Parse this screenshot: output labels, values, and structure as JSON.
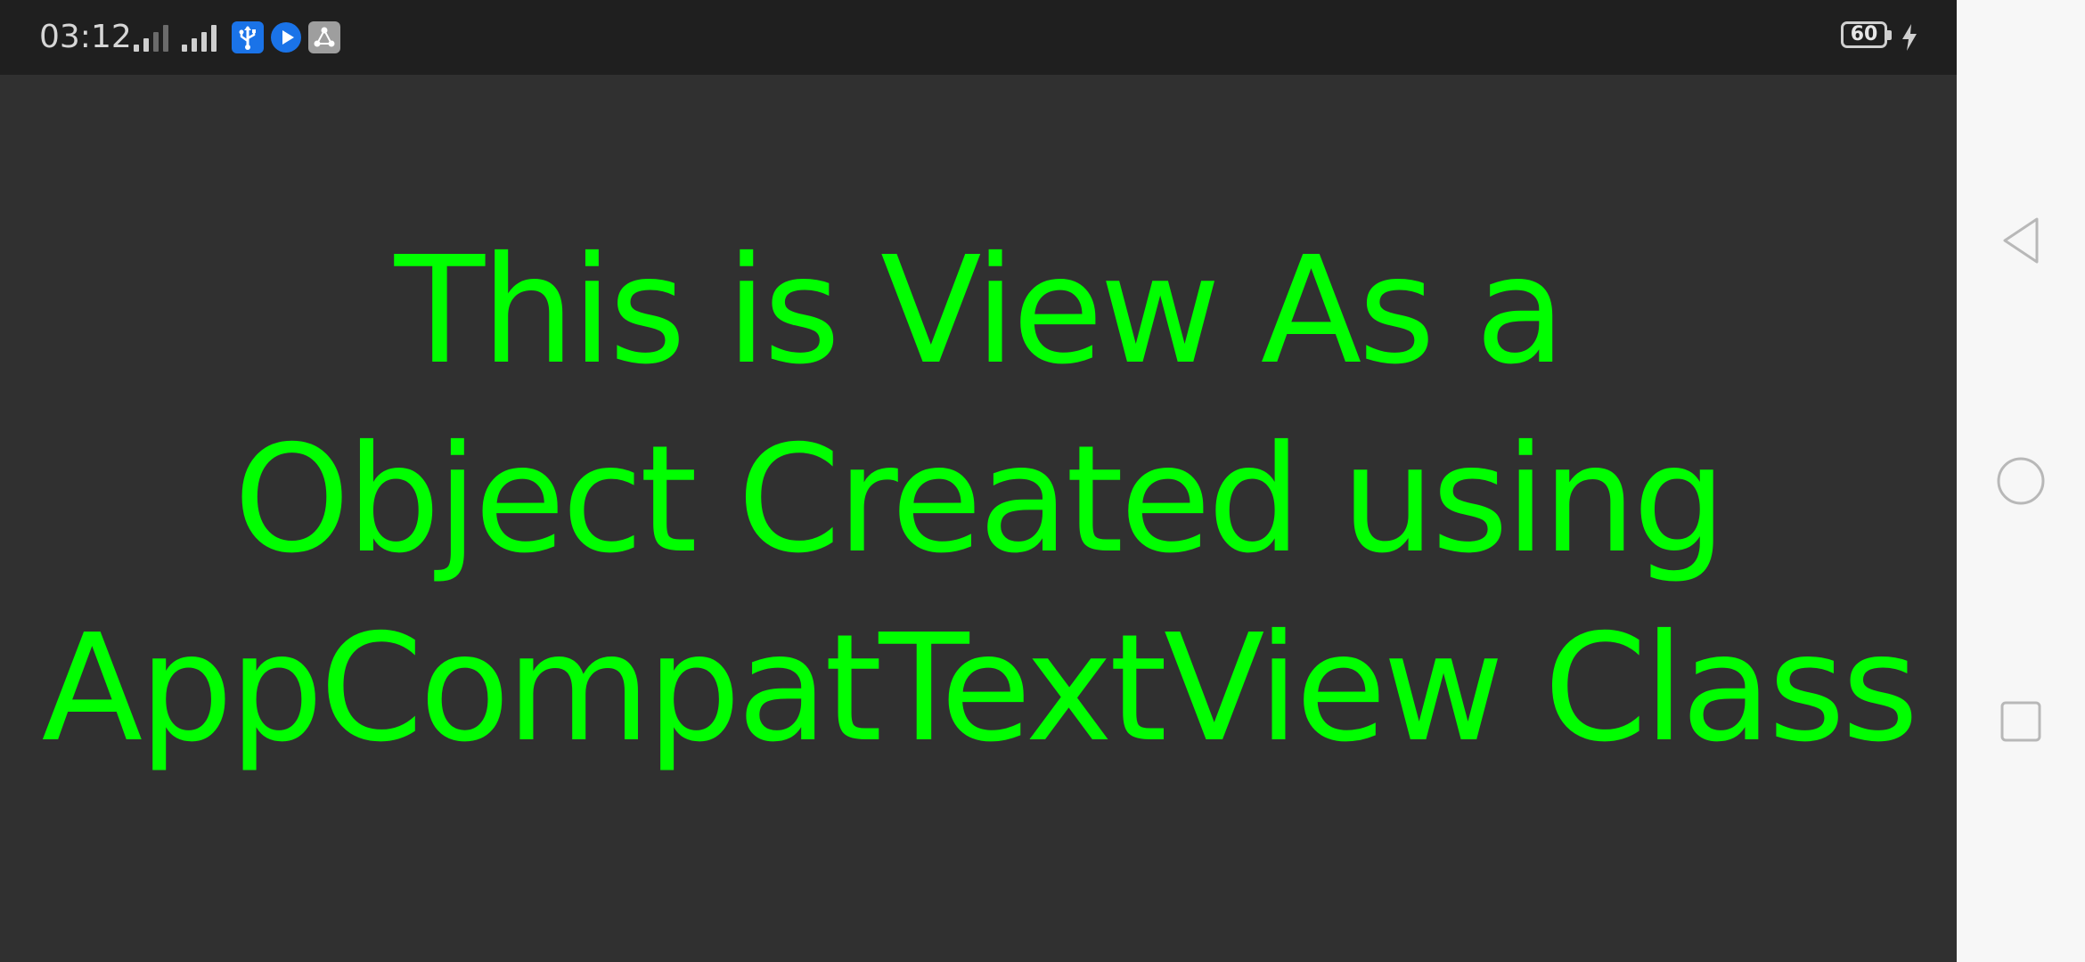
{
  "status_bar": {
    "time": "03:12",
    "battery_level": "60",
    "icons": [
      "signal-strength-icon",
      "signal-strength-icon",
      "usb-debugging-icon",
      "play-icon",
      "network-share-icon",
      "battery-icon",
      "charging-icon"
    ]
  },
  "content": {
    "message": "This is View As a\nObject Created using\nAppCompatTextView Class"
  },
  "colors": {
    "text": "#00ff00",
    "background": "#303030",
    "status_bar": "#1f1f1f",
    "nav_bar": "#f7f7f7"
  },
  "nav_bar": {
    "buttons": [
      "back-button",
      "home-button",
      "recents-button"
    ]
  }
}
